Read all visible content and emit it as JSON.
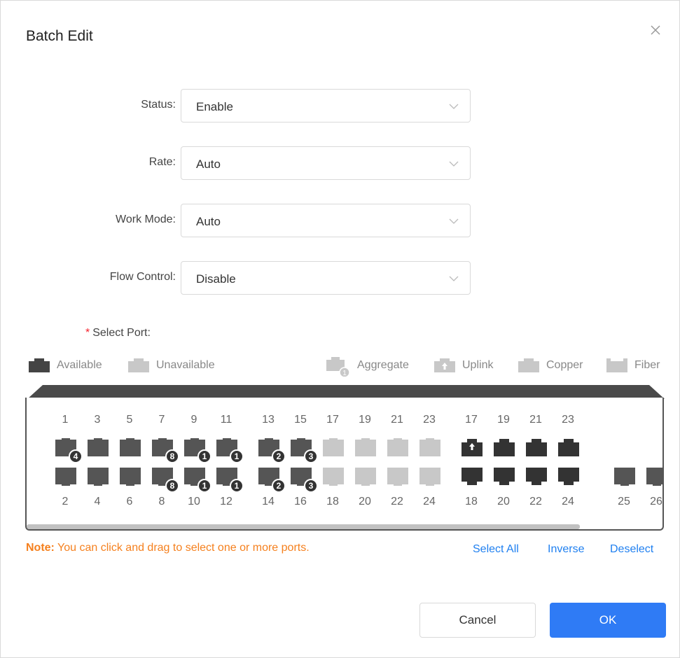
{
  "dialog": {
    "title": "Batch Edit"
  },
  "form": {
    "status": {
      "label": "Status:",
      "value": "Enable"
    },
    "rate": {
      "label": "Rate:",
      "value": "Auto"
    },
    "work_mode": {
      "label": "Work Mode:",
      "value": "Auto"
    },
    "flow_control": {
      "label": "Flow Control:",
      "value": "Disable"
    },
    "select_port": {
      "required_mark": "*",
      "label": "Select Port:"
    }
  },
  "legend": {
    "available": "Available",
    "unavailable": "Unavailable",
    "aggregate": "Aggregate",
    "aggregate_badge": "1",
    "uplink": "Uplink",
    "copper": "Copper",
    "fiber": "Fiber"
  },
  "ports": {
    "top_numbers": [
      "1",
      "3",
      "5",
      "7",
      "9",
      "11",
      "13",
      "15",
      "17",
      "19",
      "21",
      "23",
      "17",
      "19",
      "21",
      "23"
    ],
    "bottom_numbers": [
      "2",
      "4",
      "6",
      "8",
      "10",
      "12",
      "14",
      "16",
      "18",
      "20",
      "22",
      "24",
      "18",
      "20",
      "22",
      "24",
      "25",
      "26"
    ],
    "top_badges": [
      "4",
      "",
      "",
      "8",
      "1",
      "1",
      "2",
      "3"
    ],
    "bottom_badges": [
      "",
      "",
      "",
      "8",
      "1",
      "1",
      "2",
      "3"
    ]
  },
  "note": {
    "prefix": "Note:",
    "text": " You can click and drag to select one or more ports."
  },
  "actions": {
    "select_all": "Select All",
    "inverse": "Inverse",
    "deselect": "Deselect"
  },
  "buttons": {
    "cancel": "Cancel",
    "ok": "OK"
  },
  "colors": {
    "accent": "#2f7bf5",
    "note": "#f5801e",
    "port_available": "#555555",
    "port_unavailable": "#c8c8c8",
    "required": "#f5222d"
  }
}
